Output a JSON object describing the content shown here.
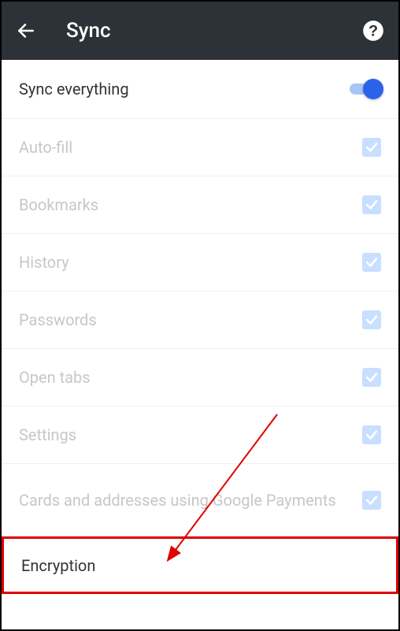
{
  "header": {
    "title": "Sync"
  },
  "master": {
    "label": "Sync everything",
    "enabled": true
  },
  "items": [
    {
      "label": "Auto-fill",
      "checked": true,
      "disabled": true
    },
    {
      "label": "Bookmarks",
      "checked": true,
      "disabled": true
    },
    {
      "label": "History",
      "checked": true,
      "disabled": true
    },
    {
      "label": "Passwords",
      "checked": true,
      "disabled": true
    },
    {
      "label": "Open tabs",
      "checked": true,
      "disabled": true
    },
    {
      "label": "Settings",
      "checked": true,
      "disabled": true
    },
    {
      "label": "Cards and addresses using Google Payments",
      "checked": true,
      "disabled": true,
      "tall": true
    }
  ],
  "encryption": {
    "label": "Encryption",
    "highlighted": true
  }
}
